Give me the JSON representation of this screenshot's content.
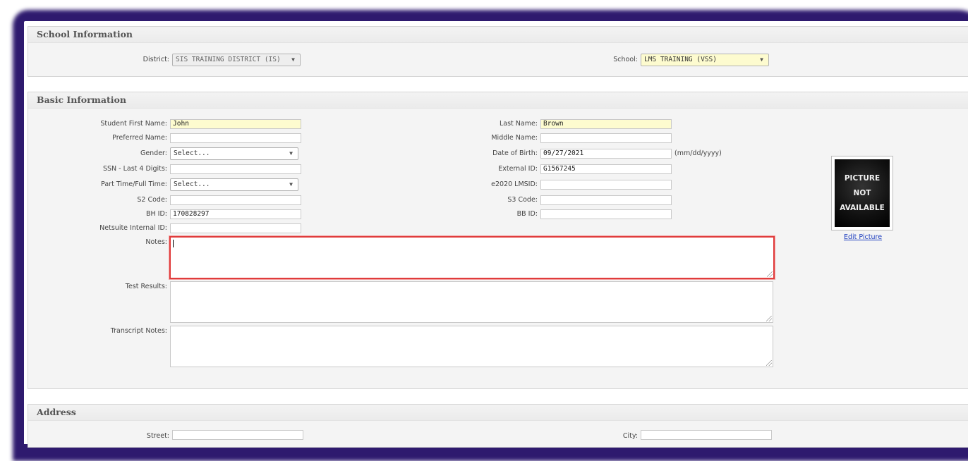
{
  "school_info": {
    "title": "School Information",
    "district_label": "District:",
    "district_value": "SIS TRAINING DISTRICT (IS)",
    "school_label": "School:",
    "school_value": "LMS TRAINING (VSS)"
  },
  "basic_info": {
    "title": "Basic Information",
    "first_name_label": "Student First Name:",
    "first_name_value": "John",
    "preferred_name_label": "Preferred Name:",
    "preferred_name_value": "",
    "gender_label": "Gender:",
    "gender_value": "Select...",
    "ssn_label": "SSN - Last 4 Digits:",
    "ssn_value": "",
    "part_time_label": "Part Time/Full Time:",
    "part_time_value": "Select...",
    "s2_label": "S2 Code:",
    "s2_value": "",
    "bh_label": "BH ID:",
    "bh_value": "170828297",
    "netsuite_label": "Netsuite Internal ID:",
    "netsuite_value": "",
    "last_name_label": "Last Name:",
    "last_name_value": "Brown",
    "middle_name_label": "Middle Name:",
    "middle_name_value": "",
    "dob_label": "Date of Birth:",
    "dob_value": "09/27/2021",
    "dob_hint": "(mm/dd/yyyy)",
    "external_id_label": "External ID:",
    "external_id_value": "G1567245",
    "lmsid_label": "e2020 LMSID:",
    "lmsid_value": "",
    "s3_label": "S3 Code:",
    "s3_value": "",
    "bb_label": "BB ID:",
    "bb_value": "",
    "notes_label": "Notes:",
    "test_results_label": "Test Results:",
    "transcript_notes_label": "Transcript Notes:",
    "picture_lines": [
      "PICTURE",
      "NOT",
      "AVAILABLE"
    ],
    "edit_picture_label": "Edit Picture"
  },
  "address": {
    "title": "Address",
    "street_label": "Street:",
    "street_value": "",
    "city_label": "City:",
    "city_value": ""
  },
  "icons": {
    "dropdown": "chevron-down-icon",
    "resize": "resize-grip-icon"
  },
  "colors": {
    "frame_shadow": "#2e1a6e",
    "required_field": "#fdfbcf",
    "focus_border": "#e03c3c",
    "link": "#1f3fbf"
  }
}
